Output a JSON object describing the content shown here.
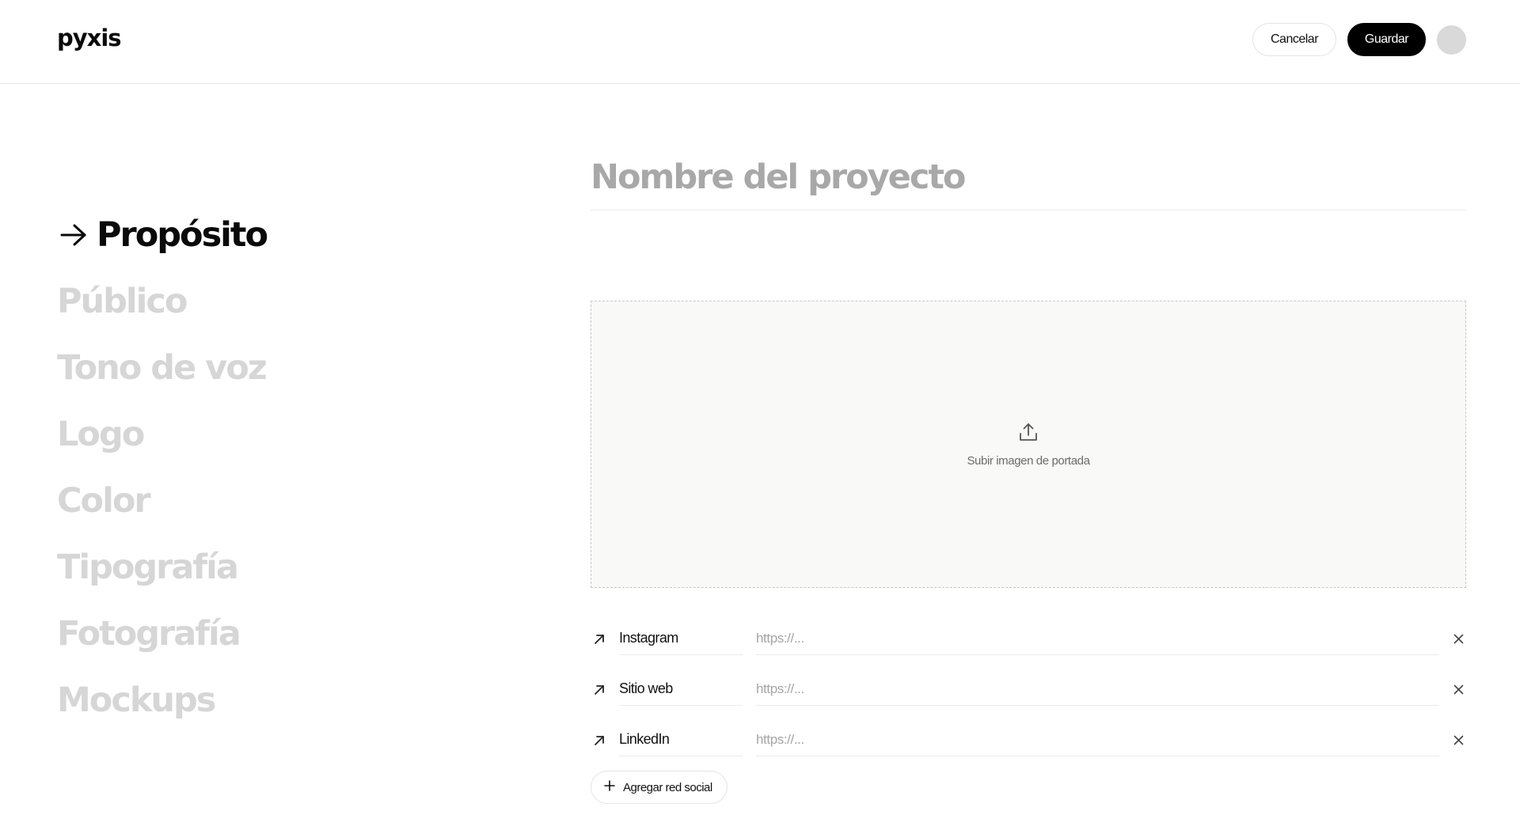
{
  "header": {
    "brand": "pyxis",
    "cancel_label": "Cancelar",
    "save_label": "Guardar"
  },
  "nav": {
    "active_icon": "arrow-right-icon",
    "items": [
      {
        "label": "Propósito",
        "active": true
      },
      {
        "label": "Público",
        "active": false
      },
      {
        "label": "Tono de voz",
        "active": false
      },
      {
        "label": "Logo",
        "active": false
      },
      {
        "label": "Color",
        "active": false
      },
      {
        "label": "Tipografía",
        "active": false
      },
      {
        "label": "Fotografía",
        "active": false
      },
      {
        "label": "Mockups",
        "active": false
      }
    ]
  },
  "project": {
    "name_value": "",
    "name_placeholder": "Nombre del proyecto"
  },
  "cover": {
    "icon": "upload-icon",
    "label": "Subir imagen de portada"
  },
  "socials": {
    "link_icon": "arrow-up-right-icon",
    "remove_icon": "close-icon",
    "items": [
      {
        "name": "Instagram",
        "url": "",
        "placeholder": "https://..."
      },
      {
        "name": "Sitio web",
        "url": "",
        "placeholder": "https://..."
      },
      {
        "name": "LinkedIn",
        "url": "",
        "placeholder": "https://..."
      }
    ],
    "add_icon": "plus-icon",
    "add_label": "Agregar red social"
  },
  "colors": {
    "primary": "#000000",
    "inactive_nav": "#d6d6d6",
    "placeholder": "#a8a8a8",
    "dropzone_bg": "#f9f9f8"
  }
}
